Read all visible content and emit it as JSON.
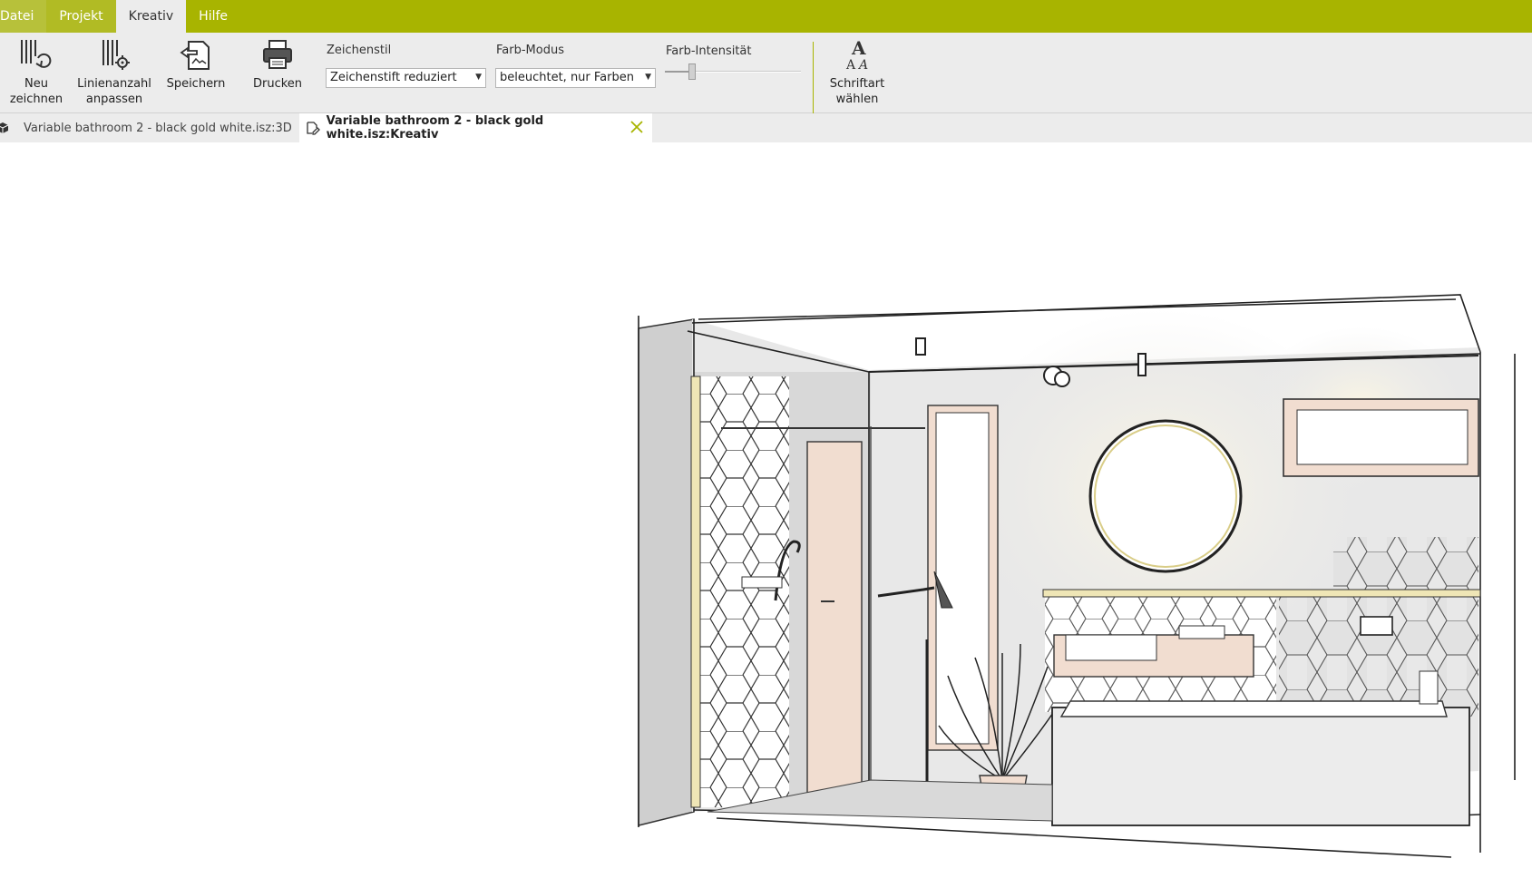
{
  "menu": {
    "tabs": [
      {
        "label": "Datei"
      },
      {
        "label": "Projekt"
      },
      {
        "label": "Kreativ"
      },
      {
        "label": "Hilfe"
      }
    ],
    "active": "Kreativ"
  },
  "ribbon": {
    "buttons": {
      "redraw": "Neu zeichnen",
      "line_count": "Linienanzahl\nanpassen",
      "save": "Speichern",
      "print": "Drucken",
      "font": "Schriftart\nwählen"
    },
    "drawing_style": {
      "label": "Zeichenstil",
      "value": "Zeichenstift reduziert"
    },
    "color_mode": {
      "label": "Farb-Modus",
      "value": "beleuchtet, nur Farben"
    },
    "color_intensity": {
      "label": "Farb-Intensität",
      "value": 0.2
    }
  },
  "doc_tabs": [
    {
      "label": "Variable bathroom 2 - black gold white.isz:3D",
      "icon": "cube-icon"
    },
    {
      "label": "Variable bathroom 2 - black gold white.isz:Kreativ",
      "icon": "sketch-icon",
      "active": true
    }
  ],
  "colors": {
    "accent": "#a8b400",
    "ribbon_bg": "#ececec",
    "gold": "#e8dfa6",
    "wood": "#f1ddd0"
  }
}
